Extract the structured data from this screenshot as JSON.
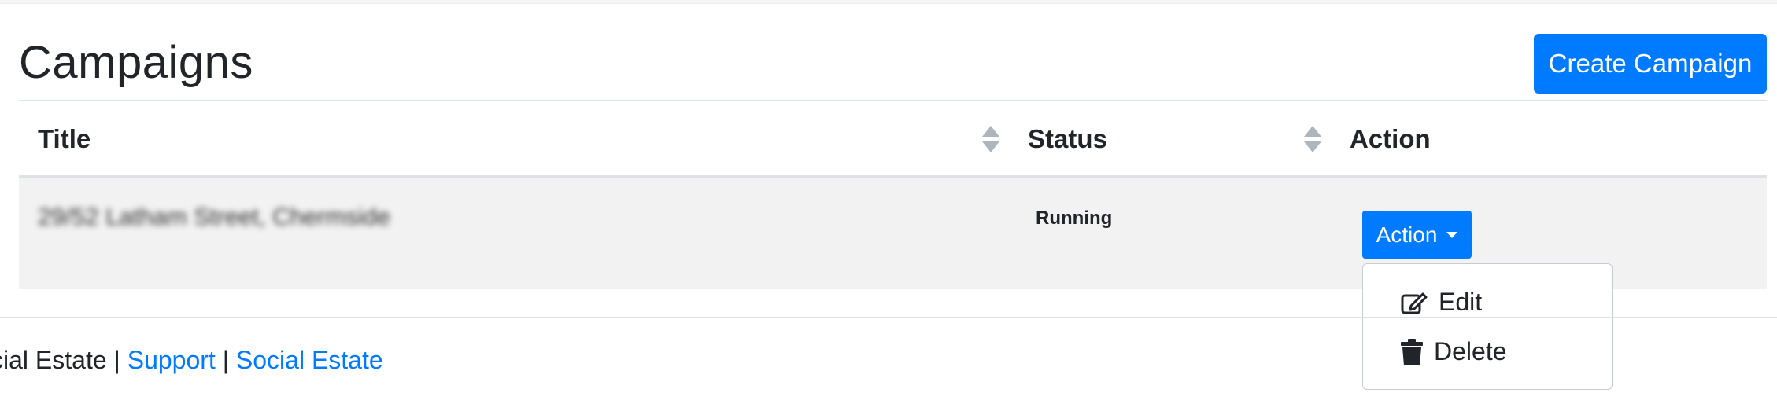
{
  "header": {
    "title": "Campaigns",
    "create_button_label": "Create Campaign"
  },
  "table": {
    "columns": [
      {
        "label": "Title",
        "sortable": true
      },
      {
        "label": "Status",
        "sortable": true
      },
      {
        "label": "Action",
        "sortable": false
      }
    ],
    "rows": [
      {
        "title": "29/52 Latham Street, Chermside",
        "status": "Running",
        "action_label": "Action"
      }
    ]
  },
  "action_menu": {
    "open": true,
    "items": [
      {
        "label": "Edit",
        "icon": "edit-icon"
      },
      {
        "label": "Delete",
        "icon": "trash-icon"
      }
    ]
  },
  "footer": {
    "text_prefix": "cial Estate",
    "separator": "|",
    "links": [
      "Support",
      "Social Estate"
    ]
  },
  "colors": {
    "primary": "#007bff",
    "row_background": "#f2f2f2",
    "text": "#212529"
  }
}
